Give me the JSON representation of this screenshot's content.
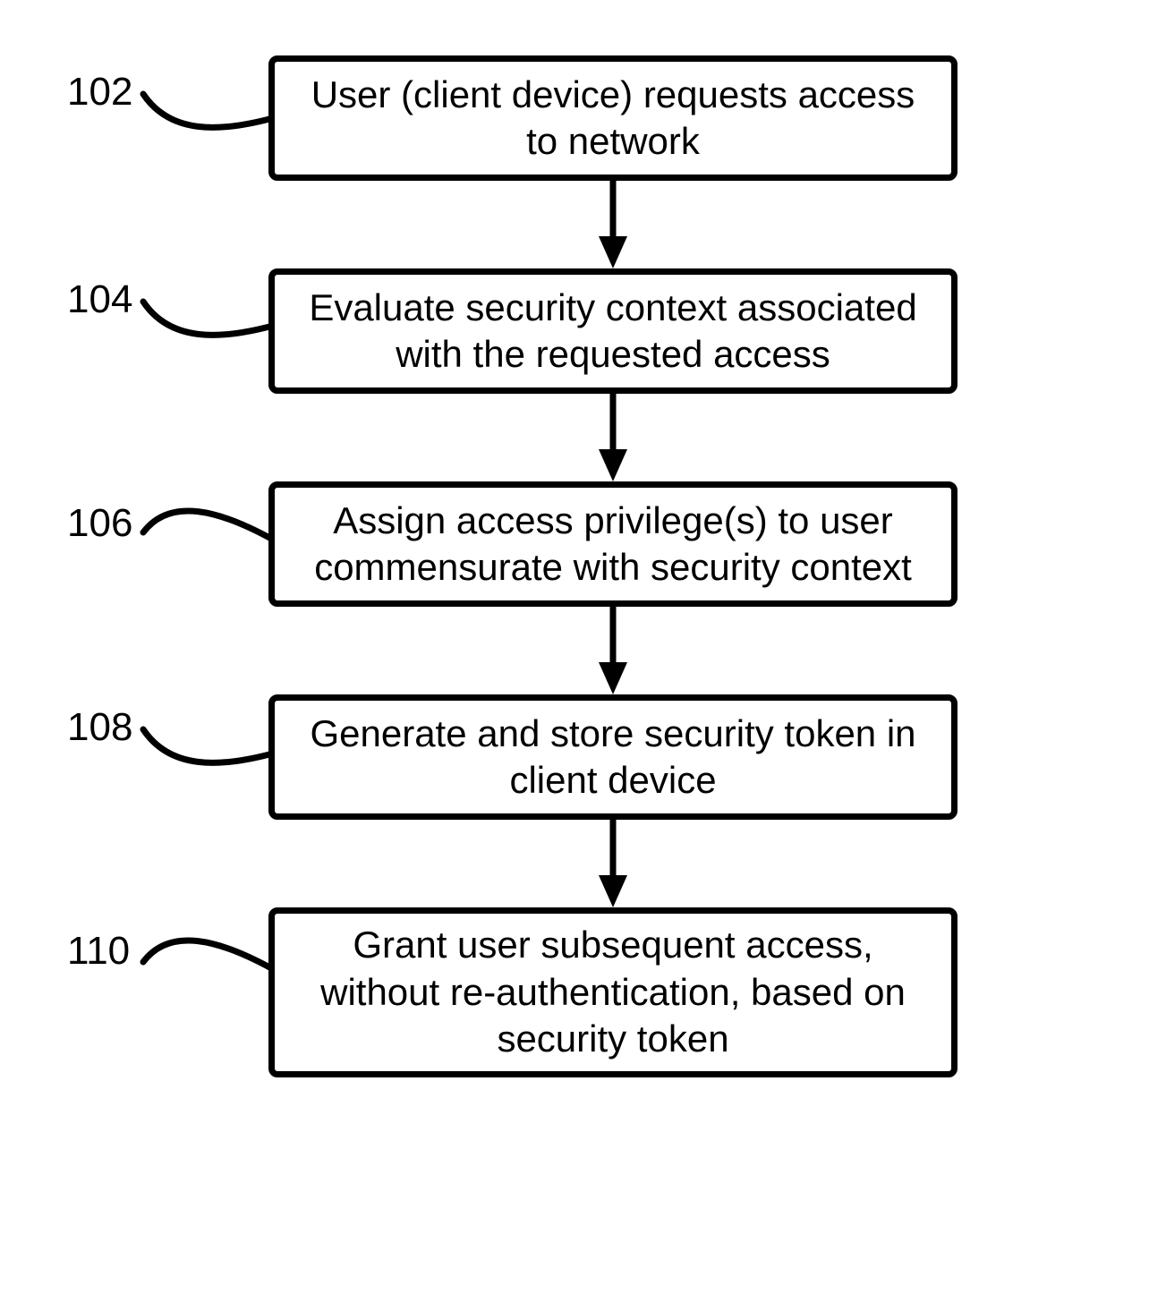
{
  "steps": [
    {
      "id": "102",
      "label": "102",
      "text": "User (client device) requests access to network"
    },
    {
      "id": "104",
      "label": "104",
      "text": "Evaluate security context associated with the requested access"
    },
    {
      "id": "106",
      "label": "106",
      "text": "Assign access privilege(s) to user commensurate with security context"
    },
    {
      "id": "108",
      "label": "108",
      "text": "Generate and store security token in client device"
    },
    {
      "id": "110",
      "label": "110",
      "text": "Grant user subsequent access, without re-authentication, based on security token"
    }
  ]
}
